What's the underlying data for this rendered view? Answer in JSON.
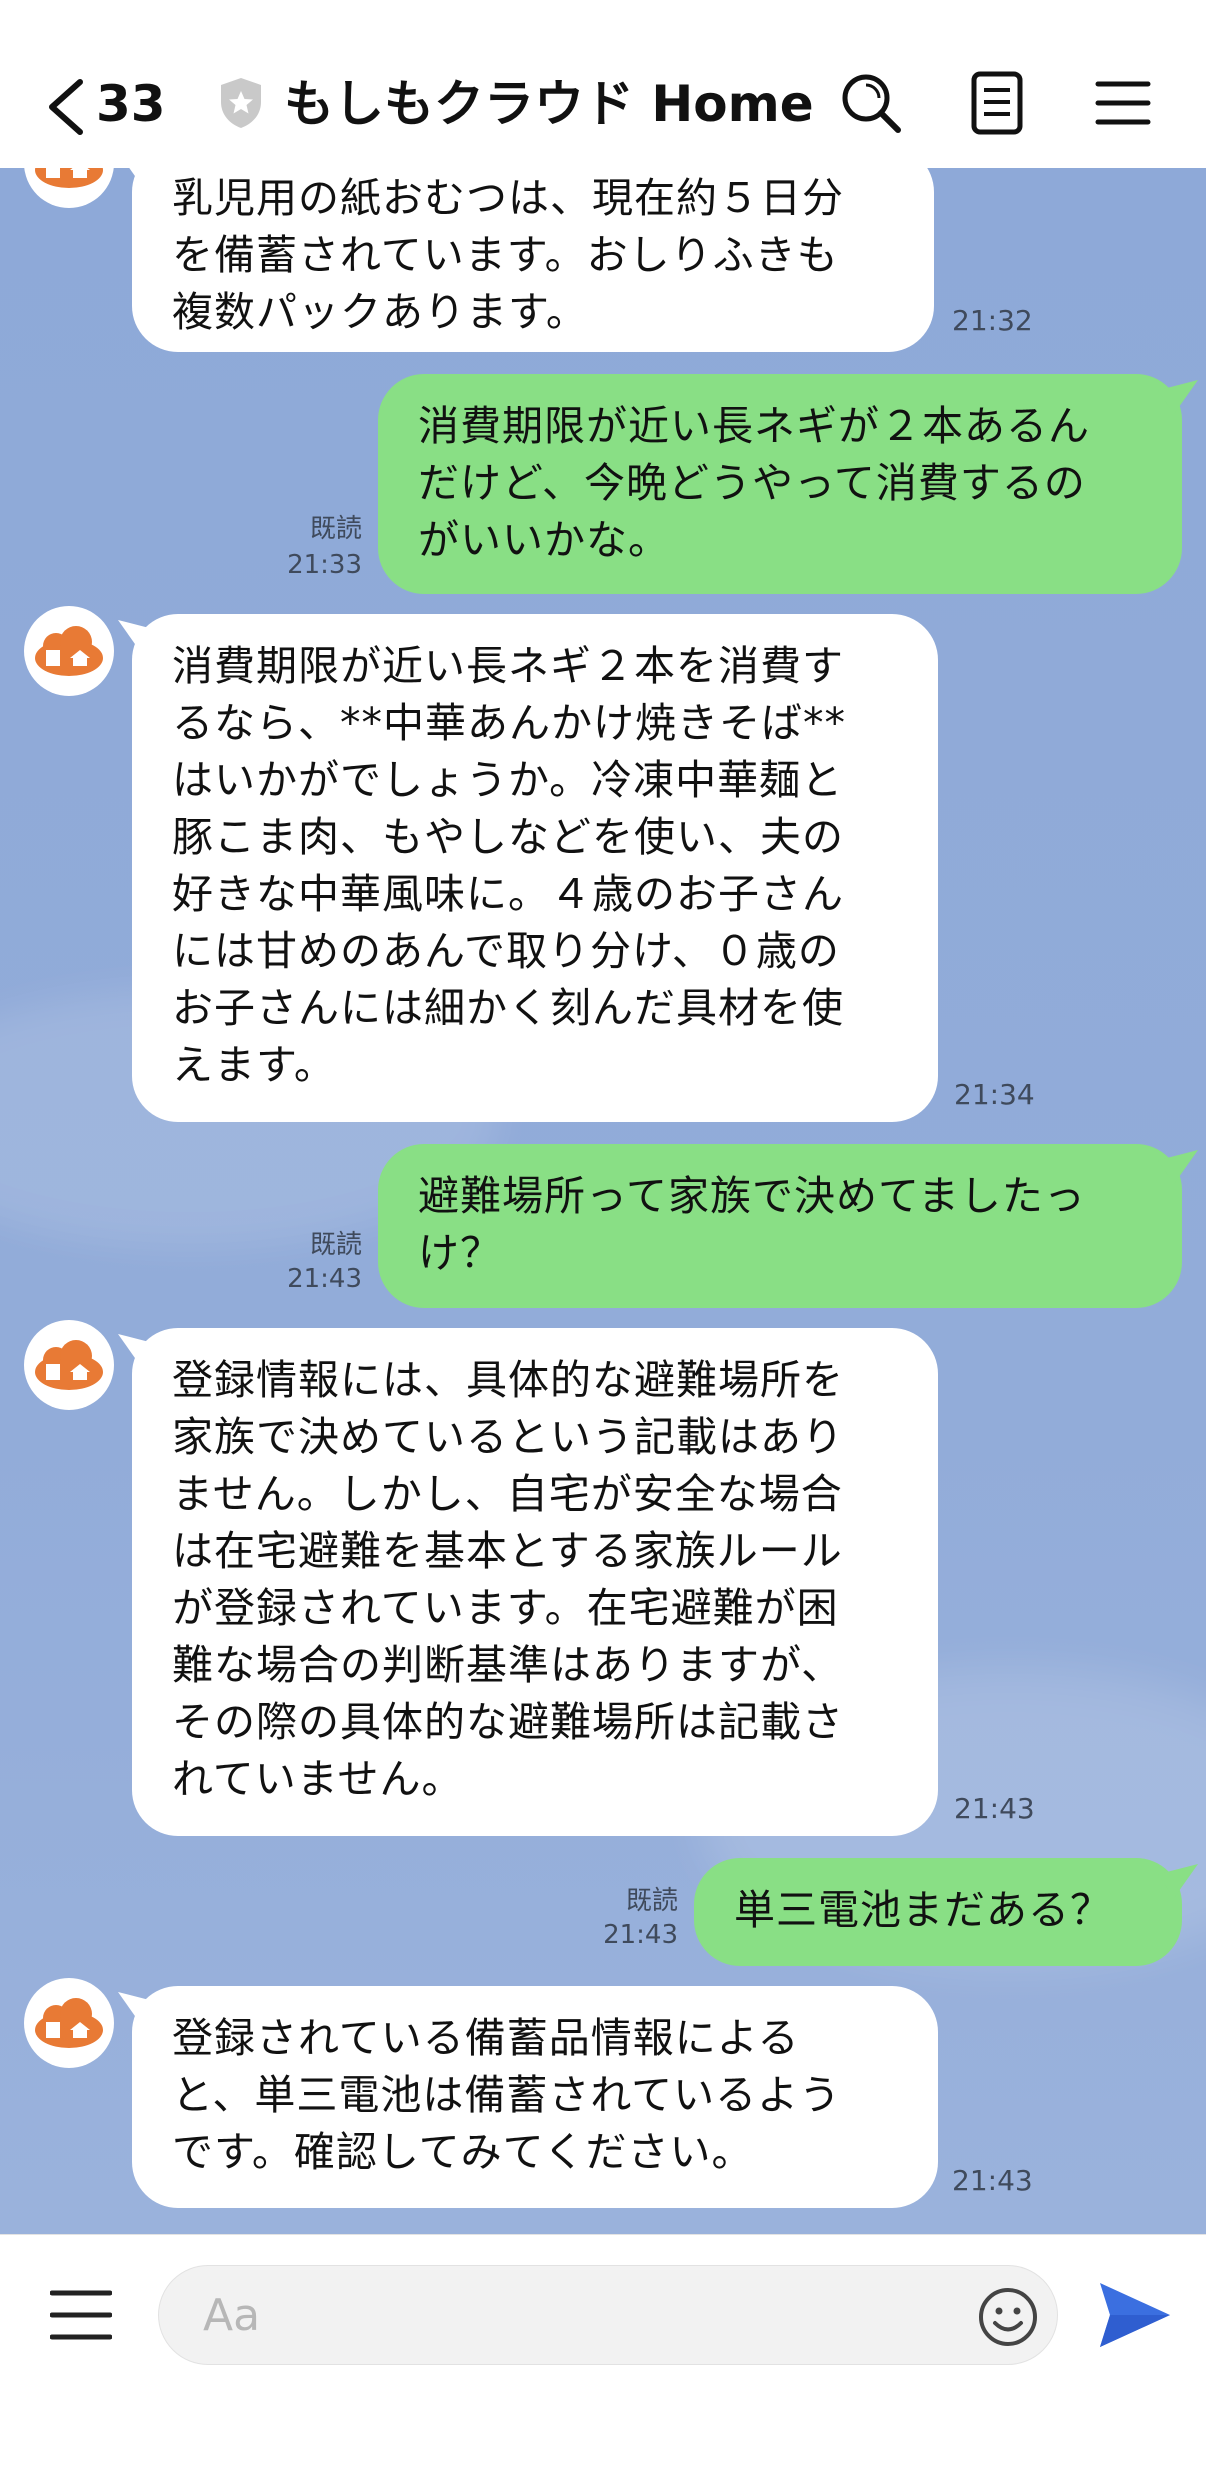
{
  "header": {
    "back_count": "33",
    "title": "もしもクラウド Home"
  },
  "messages": [
    {
      "sender": "bot",
      "text": "乳児用の紙おむつは、現在約５日分\nを備蓄されています。おしりふきも\n複数パックあります。",
      "time": "21:32"
    },
    {
      "sender": "user",
      "text": "消費期限が近い長ネギが２本あるん\nだけど、今晩どうやって消費するの\nがいいかな。",
      "read": "既読",
      "time": "21:33"
    },
    {
      "sender": "bot",
      "text": "消費期限が近い長ネギ２本を消費す\nるなら、**中華あんかけ焼きそば**\nはいかがでしょうか。冷凍中華麺と\n豚こま肉、もやしなどを使い、夫の\n好きな中華風味に。４歳のお子さん\nには甘めのあんで取り分け、０歳の\nお子さんには細かく刻んだ具材を使\nえます。",
      "time": "21:34"
    },
    {
      "sender": "user",
      "text": "避難場所って家族で決めてましたっ\nけ？",
      "read": "既読",
      "time": "21:43"
    },
    {
      "sender": "bot",
      "text": "登録情報には、具体的な避難場所を\n家族で決めているという記載はあり\nません。しかし、自宅が安全な場合\nは在宅避難を基本とする家族ルール\nが登録されています。在宅避難が困\n難な場合の判断基準はありますが、\nその際の具体的な避難場所は記載さ\nれていません。",
      "time": "21:43"
    },
    {
      "sender": "user",
      "text": "単三電池まだある？",
      "read": "既読",
      "time": "21:43"
    },
    {
      "sender": "bot",
      "text": "登録されている備蓄品情報による\nと、単三電池は備蓄されているよう\nです。確認してみてください。",
      "time": "21:43"
    }
  ],
  "input": {
    "placeholder": "Aa"
  },
  "icons": {
    "back": "chevron-left-icon",
    "shield": "shield-star-icon",
    "search": "search-icon",
    "notes": "notes-icon",
    "menu": "hamburger-menu-icon",
    "emoji": "smiley-icon",
    "send": "send-icon"
  },
  "colors": {
    "chat_background": "#8ea9d8",
    "user_bubble": "#89df85",
    "bot_bubble": "#ffffff",
    "send_button": "#3b6fe0",
    "avatar_orange": "#e87a35"
  }
}
